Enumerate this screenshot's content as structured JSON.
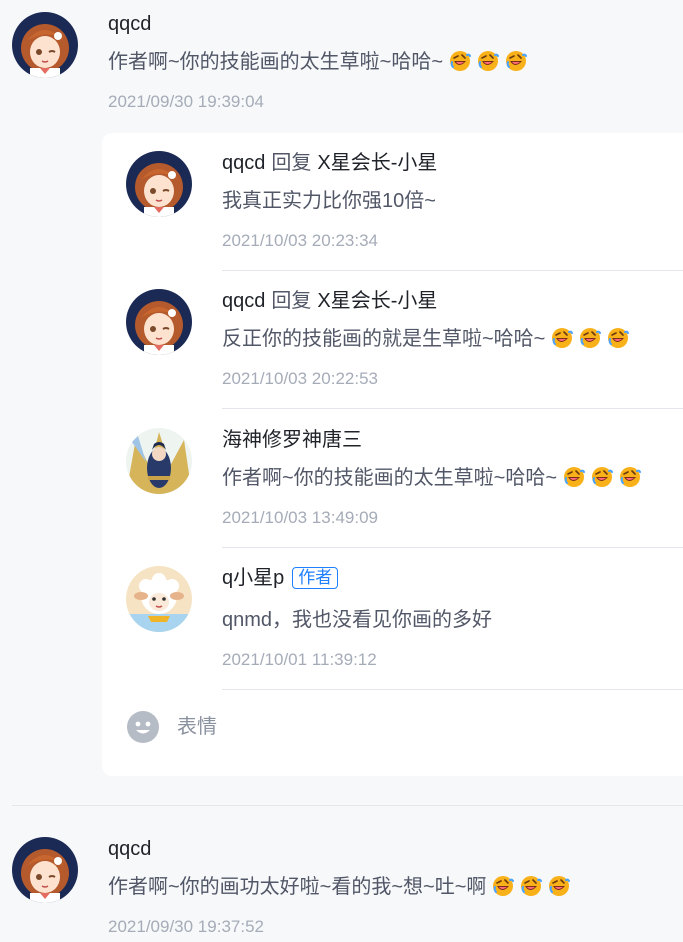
{
  "colors": {
    "page_bg": "#f7f8fa",
    "name": "#1f2329",
    "content": "#515767",
    "time": "#a5acb8",
    "badge": "#1e80ff"
  },
  "comments": [
    {
      "user": "qqcd",
      "avatar_icon": "anime-girl-avatar",
      "text": "作者啊~你的技能画的太生草啦~哈哈~",
      "emojis": [
        "rofl-emoji",
        "rofl-emoji",
        "rofl-emoji"
      ],
      "time": "2021/09/30 19:39:04"
    },
    {
      "user": "qqcd",
      "avatar_icon": "anime-girl-avatar",
      "text": "作者啊~你的画功太好啦~看的我~想~吐~啊",
      "emojis": [
        "rofl-emoji",
        "rofl-emoji",
        "rofl-emoji"
      ],
      "time": "2021/09/30 19:37:52"
    }
  ],
  "replies": [
    {
      "user": "qqcd",
      "reply_word": "回复",
      "reply_to": "X星会长-小星",
      "avatar_icon": "anime-girl-avatar",
      "text": "我真正实力比你强10倍~",
      "time": "2021/10/03 20:23:34"
    },
    {
      "user": "qqcd",
      "reply_word": "回复",
      "reply_to": "X星会长-小星",
      "avatar_icon": "anime-girl-avatar",
      "text": "反正你的技能画的就是生草啦~哈哈~",
      "emojis": [
        "rofl-emoji",
        "rofl-emoji",
        "rofl-emoji"
      ],
      "time": "2021/10/03 20:22:53"
    },
    {
      "user": "海神修罗神唐三",
      "avatar_icon": "anime-warrior-avatar",
      "text": "作者啊~你的技能画的太生草啦~哈哈~",
      "emojis": [
        "rofl-emoji",
        "rofl-emoji",
        "rofl-emoji"
      ],
      "time": "2021/10/03 13:49:09"
    },
    {
      "user": "q小星p",
      "badge": "作者",
      "avatar_icon": "sheep-avatar",
      "text": "qnmd，我也没看见你画的多好",
      "time": "2021/10/01 11:39:12"
    }
  ],
  "emoji_button": {
    "icon": "smile-icon",
    "label": "表情"
  }
}
